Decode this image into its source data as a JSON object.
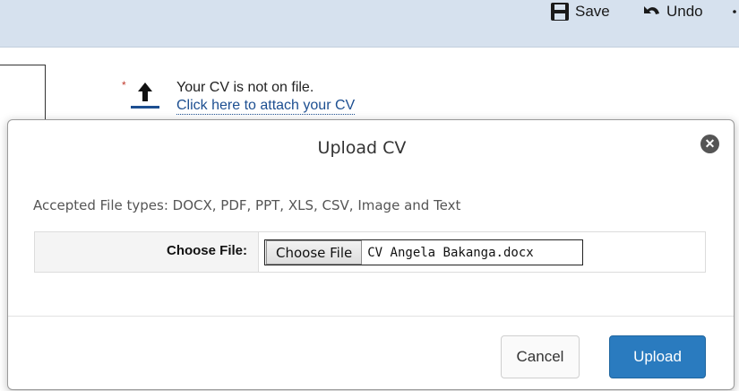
{
  "toolbar": {
    "save_label": "Save",
    "undo_label": "Undo"
  },
  "cv": {
    "required_marker": "*",
    "status": "Your CV is not on file.",
    "attach_link": "Click here to attach your CV"
  },
  "modal": {
    "title": "Upload CV",
    "accepted_types": "Accepted File types: DOCX, PDF, PPT, XLS, CSV, Image and Text",
    "choose_file_label": "Choose File:",
    "choose_file_button": "Choose File",
    "selected_file": "CV Angela Bakanga.docx",
    "cancel_label": "Cancel",
    "upload_label": "Upload",
    "close_glyph": "✕"
  },
  "colors": {
    "toolbar_bg": "#d6e1ee",
    "link": "#1d4f91",
    "primary_button": "#2a7bbf",
    "required": "#c0392b"
  },
  "icons": [
    "save-icon",
    "undo-icon",
    "upload-arrow-icon",
    "close-icon"
  ]
}
